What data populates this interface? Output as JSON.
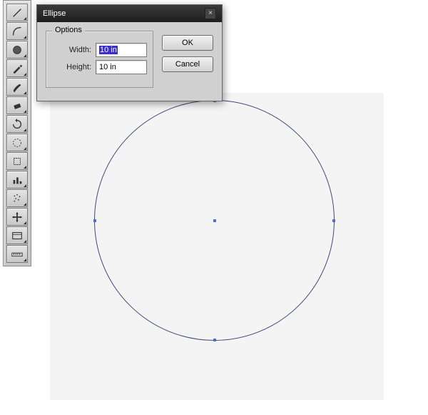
{
  "toolbar": {
    "tools": [
      {
        "name": "line-segment-tool"
      },
      {
        "name": "arc-tool"
      },
      {
        "name": "ellipse-tool"
      },
      {
        "name": "pencil-tool"
      },
      {
        "name": "paintbrush-tool"
      },
      {
        "name": "eraser-tool"
      },
      {
        "name": "rotate-tool"
      },
      {
        "name": "lasso-tool"
      },
      {
        "name": "crop-tool"
      },
      {
        "name": "graph-tool"
      },
      {
        "name": "spray-tool"
      },
      {
        "name": "move-tool"
      },
      {
        "name": "artboard-tool"
      },
      {
        "name": "measure-tool"
      }
    ]
  },
  "dialog": {
    "title": "Ellipse",
    "optionsLegend": "Options",
    "widthLabel": "Width:",
    "widthValue": "10 in",
    "heightLabel": "Height:",
    "heightValue": "10 in",
    "ok": "OK",
    "cancel": "Cancel"
  },
  "canvas": {
    "shape": "ellipse"
  }
}
